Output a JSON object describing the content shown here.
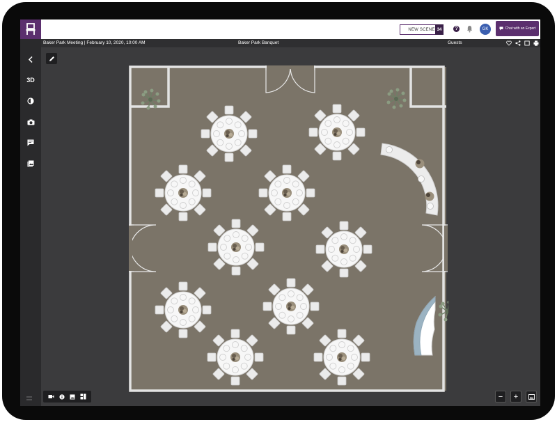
{
  "header": {
    "new_scene_label": "NEW SCENE",
    "scene_count": "34",
    "help_label": "?",
    "avatar_initials": "GK",
    "chat_label": "Chat with an Expert",
    "brand_color": "#5b2f6e"
  },
  "infobar": {
    "event": "Baker Park Meeting | February 10, 2020, 10:00 AM",
    "layout_name": "Baker Park Banquet",
    "guests_label": "Guests"
  },
  "sidebar": {
    "items": [
      {
        "label": "",
        "icon": "back-arrow-icon"
      },
      {
        "label": "3D",
        "icon": ""
      },
      {
        "label": "",
        "icon": "contrast-icon"
      },
      {
        "label": "",
        "icon": "camera-icon"
      },
      {
        "label": "",
        "icon": "comment-icon"
      },
      {
        "label": "",
        "icon": "gallery-icon"
      }
    ]
  },
  "floorplan": {
    "round_tables": 10,
    "chairs_per_table": 8,
    "bar_places": 3,
    "plants": 3,
    "floor_color": "#7b7468"
  },
  "bottom_controls": {
    "left_icons": [
      "video-icon",
      "info-icon",
      "image-icon",
      "layout-icon"
    ],
    "zoom_out_label": "−",
    "zoom_in_label": "+"
  }
}
